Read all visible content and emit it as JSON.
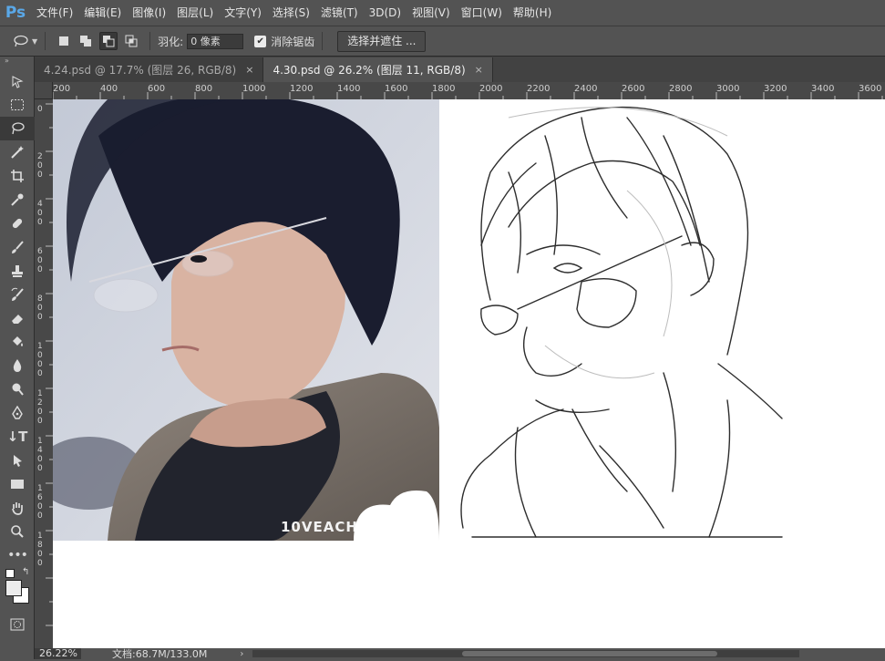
{
  "app": {
    "logo": "Ps"
  },
  "menu": [
    "文件(F)",
    "编辑(E)",
    "图像(I)",
    "图层(L)",
    "文字(Y)",
    "选择(S)",
    "滤镜(T)",
    "3D(D)",
    "视图(V)",
    "窗口(W)",
    "帮助(H)"
  ],
  "options": {
    "feather_label": "羽化:",
    "feather_value": "0 像素",
    "antialias_label": "消除锯齿",
    "select_mask_label": "选择并遮住 ..."
  },
  "tabs": [
    {
      "label": "4.24.psd @ 17.7% (图层 26, RGB/8)",
      "close": "×"
    },
    {
      "label": "4.30.psd @ 26.2% (图层 11, RGB/8)",
      "close": "×"
    }
  ],
  "ruler_h": [
    "200",
    "400",
    "600",
    "800",
    "1000",
    "1200",
    "1400",
    "1600",
    "1800",
    "2000",
    "2200",
    "2400",
    "2600",
    "2800",
    "3000",
    "3200",
    "3400",
    "3600"
  ],
  "ruler_v": [
    "0",
    "2 0 0",
    "4 0 0",
    "6 0 0",
    "8 0 0",
    "1 0 0 0",
    "1 2 0 0",
    "1 4 0 0",
    "1 6 0 0",
    "1 8 0 0"
  ],
  "canvas": {
    "watermark": "10VEACHV"
  },
  "status": {
    "zoom": "26.22%",
    "doc": "文档:68.7M/133.0M"
  }
}
